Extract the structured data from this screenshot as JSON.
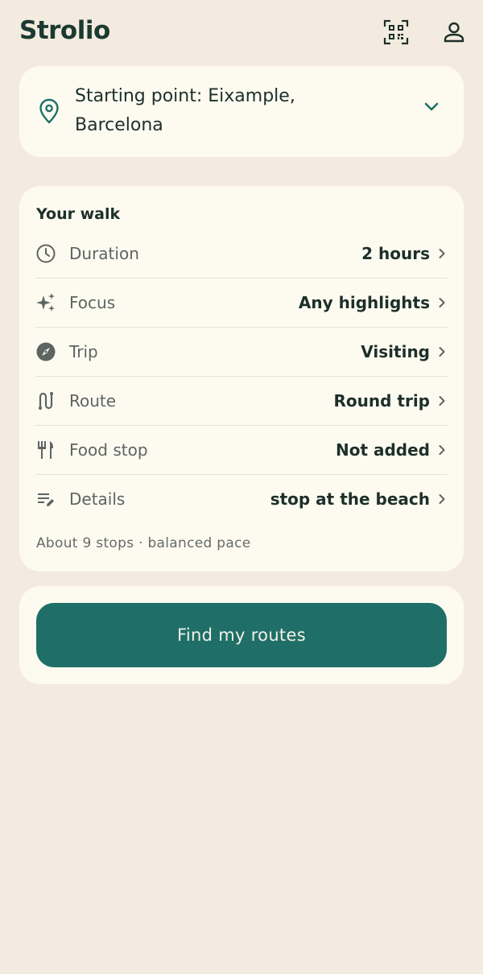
{
  "app": {
    "title": "Strolio"
  },
  "header": {
    "qr_icon": "qr-code-icon",
    "profile_icon": "person-icon"
  },
  "start": {
    "label": "Starting point: Eixample, Barcelona",
    "icon": "map-pin-icon",
    "expand_icon": "chevron-down-icon"
  },
  "walk": {
    "title": "Your walk",
    "rows": [
      {
        "label": "Duration",
        "value": "2 hours",
        "icon": "clock-icon"
      },
      {
        "label": "Focus",
        "value": "Any highlights",
        "icon": "sparkle-icon"
      },
      {
        "label": "Trip",
        "value": "Visiting",
        "icon": "compass-icon"
      },
      {
        "label": "Route",
        "value": "Round trip",
        "icon": "route-icon"
      },
      {
        "label": "Food stop",
        "value": "Not added",
        "icon": "utensils-icon"
      },
      {
        "label": "Details",
        "value": "stop at the beach",
        "icon": "edit-notes-icon"
      }
    ],
    "summary": "About 9 stops · balanced pace"
  },
  "cta": {
    "label": "Find my routes"
  },
  "colors": {
    "background": "#f3ebdf",
    "card": "#fdfbf0",
    "accent": "#1f6f68",
    "text": "#1d2f2a"
  }
}
